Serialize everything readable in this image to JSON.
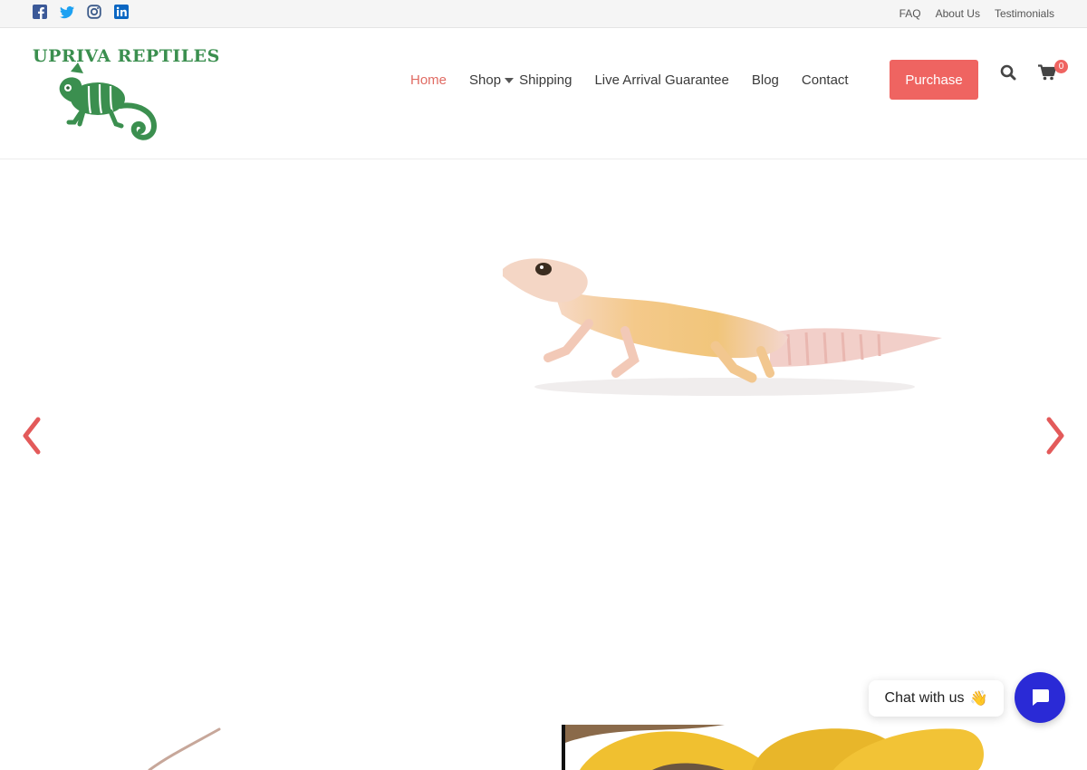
{
  "topbar": {
    "social": [
      "facebook-icon",
      "twitter-icon",
      "instagram-icon",
      "linkedin-icon"
    ],
    "links": [
      {
        "label": "FAQ"
      },
      {
        "label": "About Us"
      },
      {
        "label": "Testimonials"
      }
    ]
  },
  "header": {
    "logo_text": "UPRIVA REPTILES",
    "nav": [
      {
        "label": "Home",
        "active": true
      },
      {
        "label": "Shop",
        "has_dropdown": true
      },
      {
        "label": "Shipping"
      },
      {
        "label": "Live Arrival Guarantee"
      },
      {
        "label": "Blog"
      },
      {
        "label": "Contact"
      }
    ],
    "purchase_label": "Purchase",
    "cart_count": "0"
  },
  "hero": {
    "prev": "chevron-left-icon",
    "next": "chevron-right-icon"
  },
  "chat": {
    "label": "Chat with us",
    "emoji": "👋"
  },
  "colors": {
    "accent": "#ef6461",
    "logo_green": "#3b8f4f",
    "chat_blue": "#2a2ad6"
  }
}
